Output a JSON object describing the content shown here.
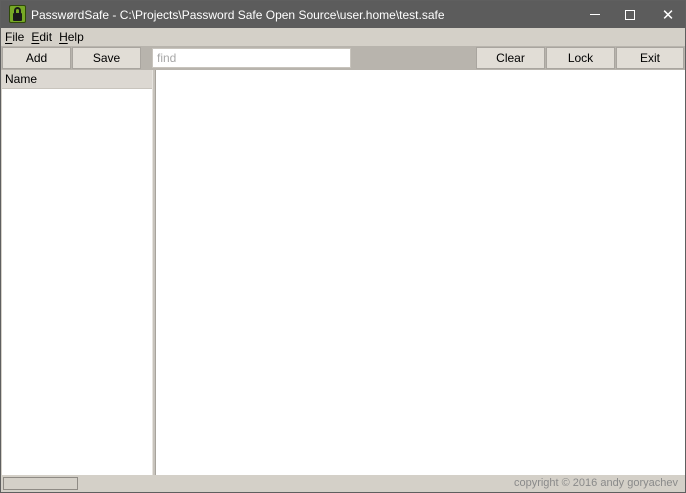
{
  "window": {
    "title": "PasswørdSafe - C:\\Projects\\Password Safe Open Source\\user.home\\test.safe",
    "app_icon": "padlock-icon",
    "controls": {
      "minimize": "minimize-icon",
      "maximize": "maximize-icon",
      "close_glyph": "✕"
    }
  },
  "menu": {
    "file": {
      "mnemonic": "F",
      "rest": "ile"
    },
    "edit": {
      "mnemonic": "E",
      "rest": "dit"
    },
    "help": {
      "mnemonic": "H",
      "rest": "elp"
    }
  },
  "toolbar": {
    "add_label": "Add",
    "save_label": "Save",
    "find_placeholder": "find",
    "find_value": "",
    "clear_label": "Clear",
    "lock_label": "Lock",
    "exit_label": "Exit"
  },
  "list": {
    "column_header": "Name",
    "items": []
  },
  "status": {
    "progress": 0,
    "copyright": "copyright © 2016 andy goryachev"
  },
  "colors": {
    "titlebar": "#5c5c5c",
    "toolbar": "#b8b4ad",
    "chrome": "#d4d0c8",
    "icon_green": "#77a826"
  }
}
